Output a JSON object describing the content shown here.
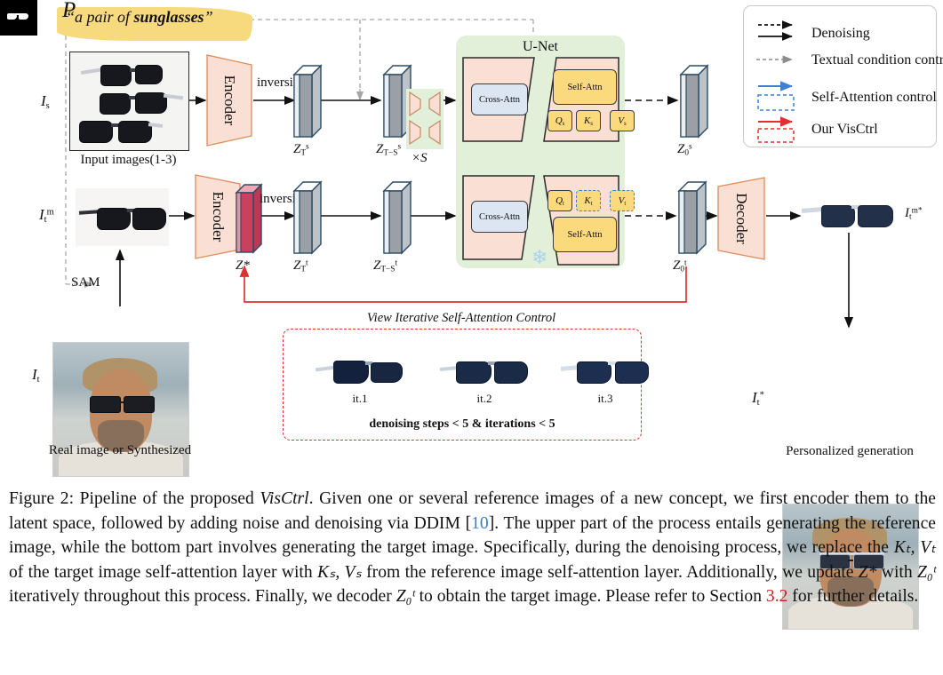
{
  "figure": {
    "prompt": {
      "symbol": "P",
      "quote_open": "“",
      "text_plain": "a pair of ",
      "text_bold": "sunglasses",
      "quote_close": "”"
    },
    "unet": {
      "title": "U-Net",
      "cross_attn_label": "Cross-Attn",
      "self_attn_label": "Self-Attn",
      "qkv_source": [
        "Q",
        "K",
        "V"
      ],
      "qkv_source_sub": "s",
      "qkv_target": [
        "Q",
        "K",
        "V"
      ],
      "qkv_target_sub": "t",
      "frozen_icon": "snowflake-icon"
    },
    "encoder_label": "Encoder",
    "decoder_label": "Decoder",
    "inversion_label": "inversion",
    "sam_label": "SAM",
    "repeat_label": "×S",
    "captions_under_images": {
      "input_images": "Input images(1-3)",
      "target_image": "Real image or Synthesized",
      "result_image": "Personalized generation"
    },
    "symbols": {
      "source_image": "I",
      "source_image_sub": "s",
      "target_masked": "I",
      "target_masked_sub": "t",
      "target_masked_sup": "m",
      "target_image": "I",
      "target_image_sub": "t",
      "result_masked": "I",
      "result_masked_sub": "t",
      "result_masked_sup": "m*",
      "result_image": "I",
      "result_image_sub": "t",
      "result_image_sup": "*",
      "z_star": "Z*",
      "zTs": "Z",
      "zTs_sub": "T",
      "zTs_sup": "s",
      "zTSs": "Z",
      "zTSs_sub": "T−S",
      "zTSs_sup": "s",
      "z0s": "Z",
      "z0s_sub": "0",
      "z0s_sup": "s",
      "zTt": "Z",
      "zTt_sub": "T",
      "zTt_sup": "t",
      "zTSt": "Z",
      "zTSt_sub": "T−S",
      "zTSt_sup": "t",
      "z0t": "Z",
      "z0t_sub": "0",
      "z0t_sup": "t"
    },
    "iteration_panel": {
      "title": "View Iterative Self-Attention Control",
      "steps": [
        "it.1",
        "it.2",
        "it.3"
      ],
      "footer": "denoising steps < 5 & iterations < 5"
    },
    "legend": {
      "items": [
        {
          "label": "Denoising",
          "style": "black-dashed-and-solid-arrow"
        },
        {
          "label": "Textual condition control",
          "style": "gray-dashed-arrow"
        },
        {
          "label": "Self-Attention control",
          "style": "blue-arrow-and-dashed-box"
        },
        {
          "label": "Our VisCtrl",
          "style": "red-arrow-and-dashed-box"
        }
      ]
    },
    "colors": {
      "unet_panel": "#e2efd9",
      "encoder_decoder": "#fae0d4",
      "cross_attn": "#dce6f2",
      "self_attn": "#fbd97d",
      "prompt_banner": "#f7d97e",
      "z_star": "#c9415e",
      "latent_slab": "#9aa0a6",
      "blue_arrow": "#3d7fd4",
      "red_arrow": "#e03131",
      "gray_dashed": "#a6a6a6"
    }
  },
  "caption": {
    "prefix": "Figure 2: Pipeline of the proposed ",
    "emph1": "VisCtrl",
    "part1": ". Given one or several reference images of a new concept, we first encoder them to the latent space, followed by adding noise and denoising via DDIM [",
    "ref1": "10",
    "part2": "]. The upper part of the process entails generating the reference image, while the bottom part involves generating the target image. Specifically, during the denoising process, we replace the ",
    "kt_vt": "Kₜ, Vₜ",
    "part3": " of the target image self-attention layer with ",
    "ks_vs": "Kₛ, Vₛ",
    "part4": " from the reference image self-attention layer. Additionally, we update ",
    "zstar": "Z*",
    "part5": " with ",
    "z0t": "Z₀ᵗ",
    "part6": " iteratively throughout this process. Finally, we decoder ",
    "z0t2": "Z₀ᵗ",
    "part7": " to obtain the target image. Please refer to Section ",
    "section_ref": "3.2",
    "part8": " for further details."
  }
}
